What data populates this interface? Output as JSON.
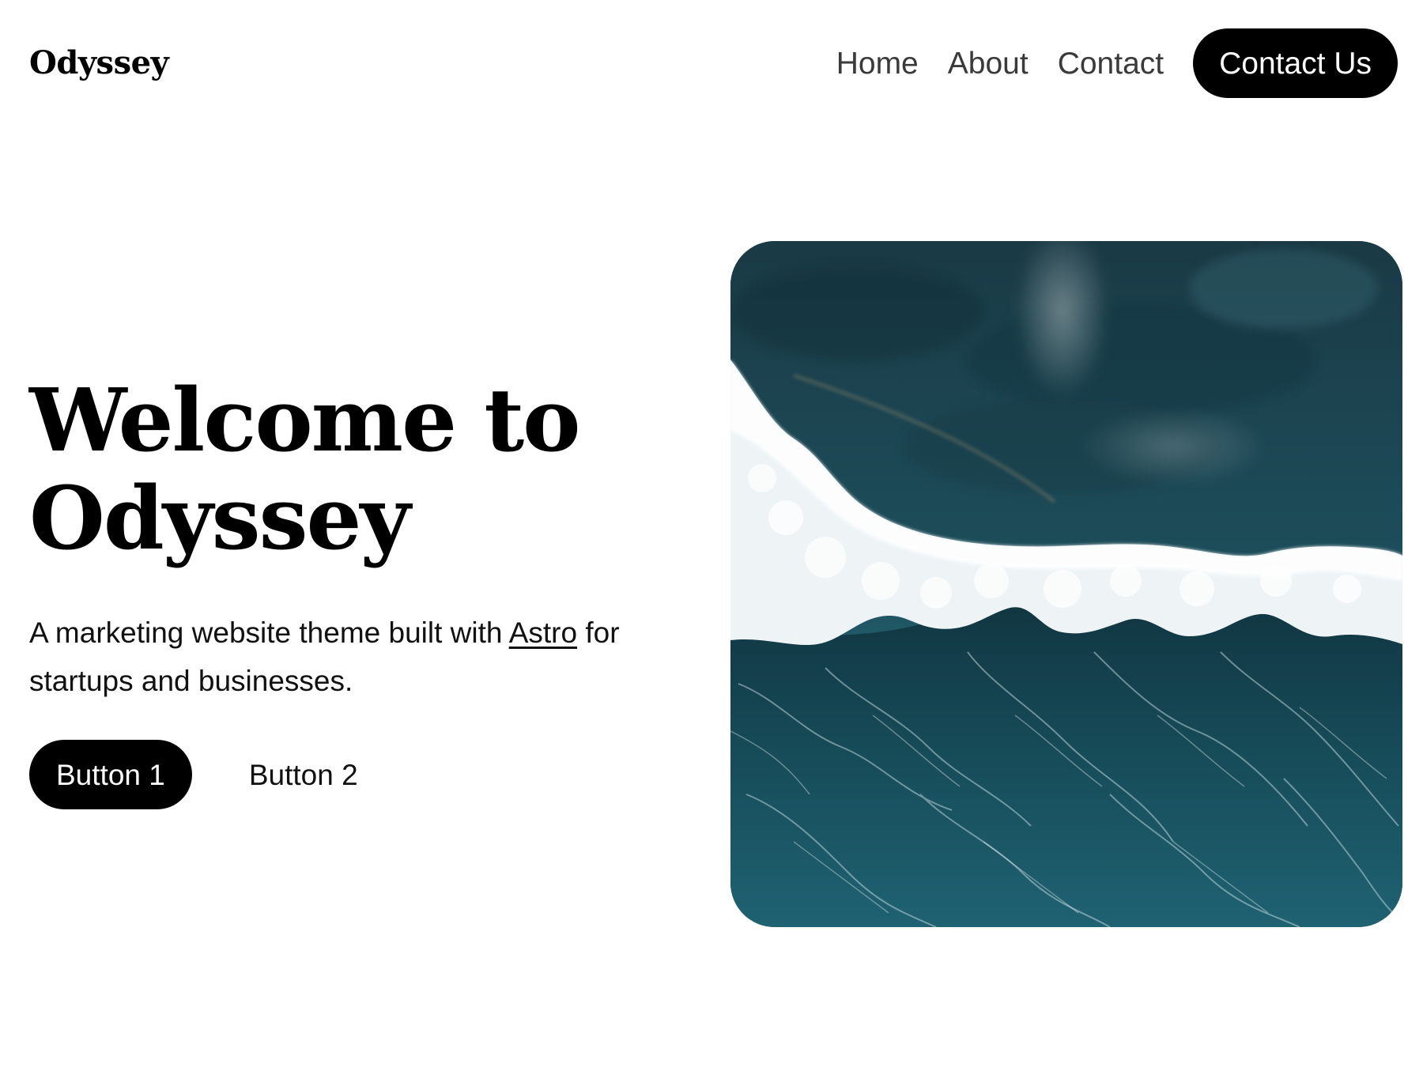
{
  "header": {
    "brand": "Odyssey",
    "nav": {
      "home": "Home",
      "about": "About",
      "contact": "Contact"
    },
    "cta_label": "Contact Us"
  },
  "hero": {
    "title_line_1": "Welcome to",
    "title_line_2": "Odyssey",
    "subtitle_before": "A marketing website theme built with ",
    "subtitle_link": "Astro",
    "subtitle_after": " for startups and businesses.",
    "button_1": "Button 1",
    "button_2": "Button 2",
    "image_subject": "aerial-ocean-wave-photo"
  },
  "colors": {
    "background": "#ffffff",
    "text": "#000000",
    "muted_nav": "#3a3a3a",
    "button_bg": "#000000",
    "button_text": "#ffffff",
    "ocean_dark": "#0f2f3a",
    "ocean_mid": "#1f5b68",
    "foam": "#f3f7f8"
  }
}
